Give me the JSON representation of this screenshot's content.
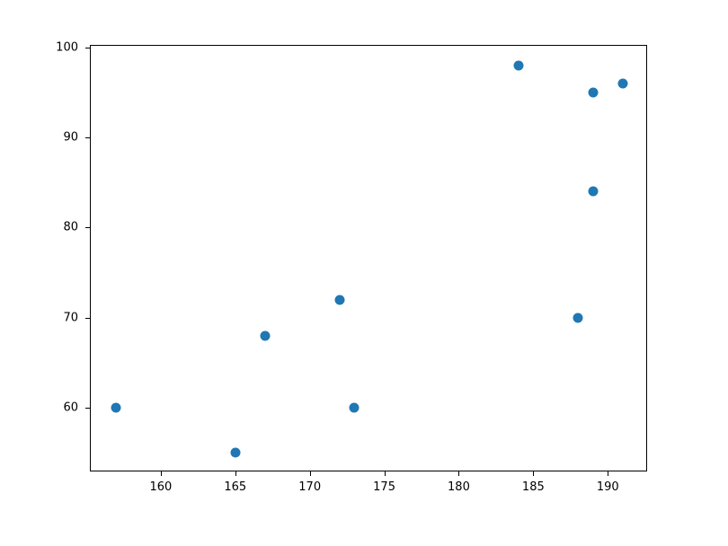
{
  "chart_data": {
    "type": "scatter",
    "x": [
      157,
      165,
      167,
      172,
      173,
      184,
      188,
      189,
      189,
      191
    ],
    "y": [
      60,
      55,
      68,
      72,
      60,
      98,
      70,
      95,
      84,
      96
    ],
    "title": "",
    "xlabel": "",
    "ylabel": "",
    "xlim": [
      155.3,
      192.7
    ],
    "ylim": [
      52.85,
      100.15
    ],
    "xticks": [
      160,
      165,
      170,
      175,
      180,
      185,
      190
    ],
    "yticks": [
      60,
      70,
      80,
      90,
      100
    ],
    "marker_color": "#1f77b4"
  }
}
